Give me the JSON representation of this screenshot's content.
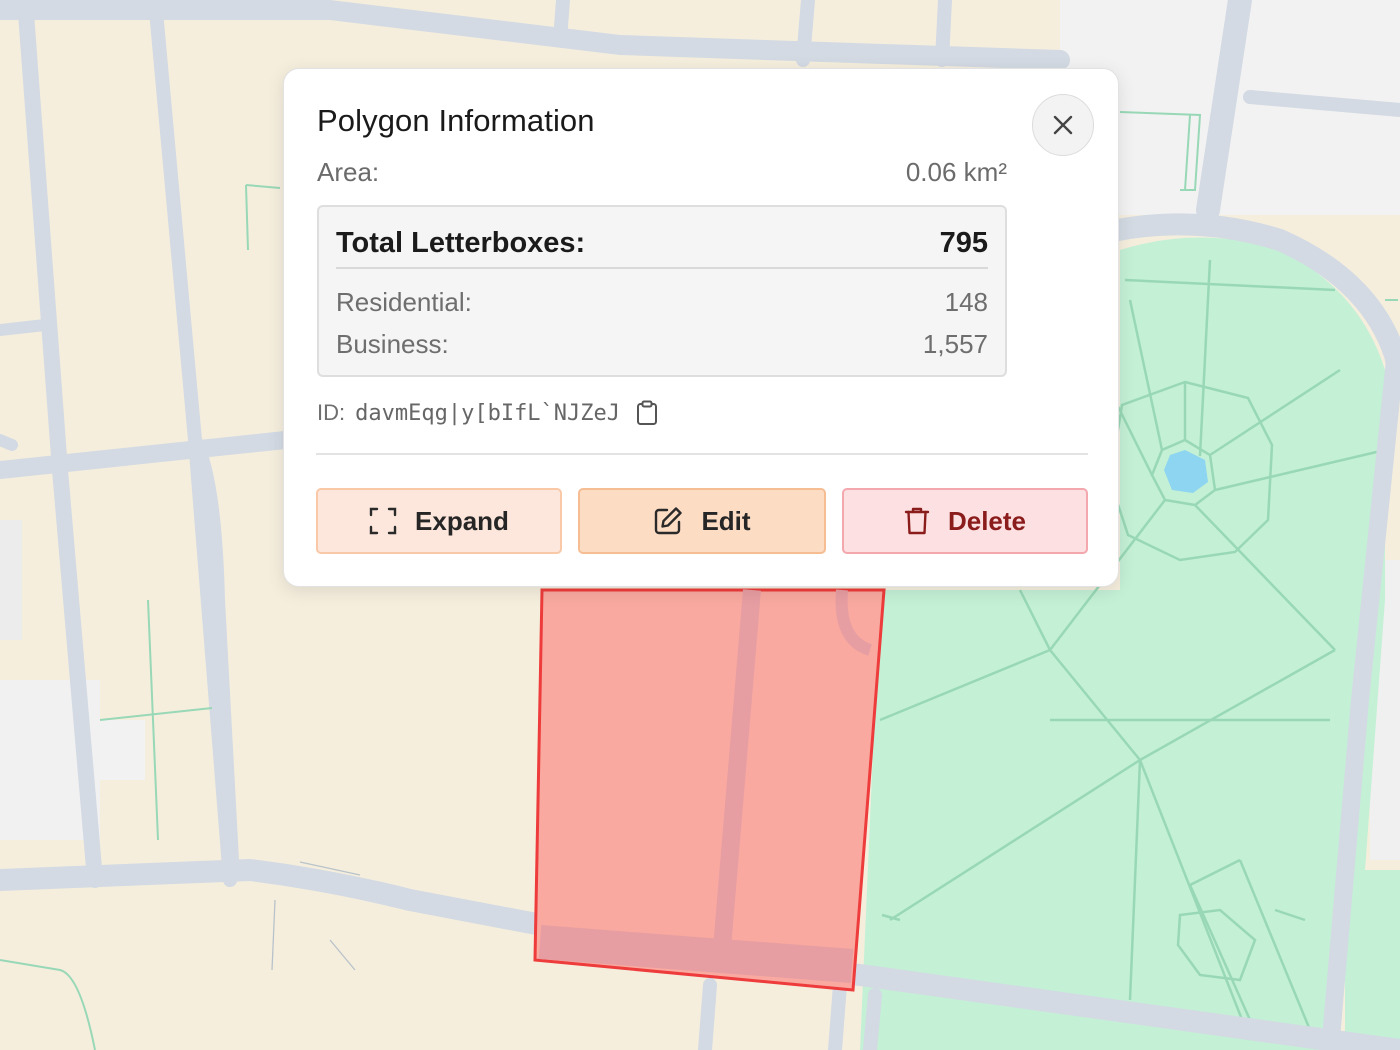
{
  "popup": {
    "title": "Polygon Information",
    "area_label": "Area:",
    "area_value": "0.06 km²",
    "total_label": "Total Letterboxes:",
    "total_value": "795",
    "residential_label": "Residential:",
    "residential_value": "148",
    "business_label": "Business:",
    "business_value": "1,557",
    "id_label": "ID:",
    "id_value": "davmEqg|y[bIfL`NJZeJ",
    "buttons": {
      "expand": "Expand",
      "edit": "Edit",
      "delete": "Delete"
    }
  },
  "icons": [
    "close-icon",
    "clipboard-icon",
    "expand-icon",
    "edit-icon",
    "trash-icon"
  ],
  "colors": {
    "polygon_fill": "#f9a99f",
    "polygon_stroke": "#ee3b3b",
    "park": "#c4f0d6",
    "water": "#8dd5f0",
    "road": "#d3dae3",
    "building": "#f5eedd",
    "expand_bg": "#fde7dc",
    "edit_bg": "#fddcc4",
    "delete_bg": "#fde0e2",
    "delete_text": "#8b1c1c"
  }
}
